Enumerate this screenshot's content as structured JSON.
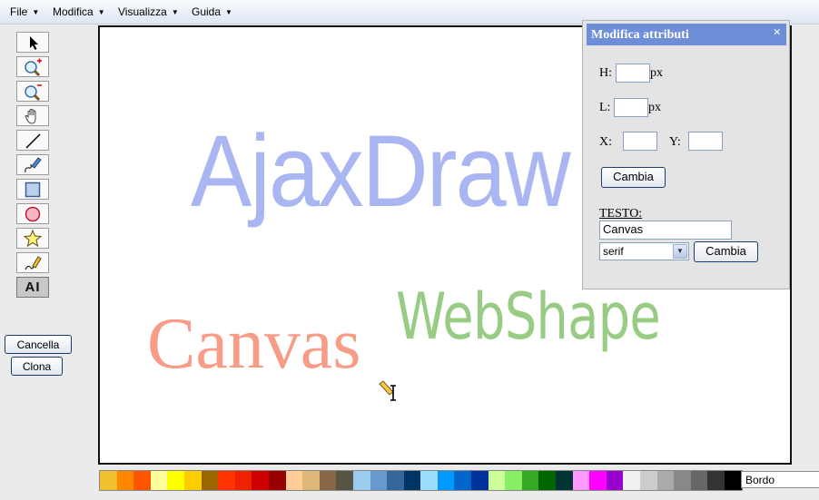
{
  "menu": [
    {
      "label": "File"
    },
    {
      "label": "Modifica"
    },
    {
      "label": "Visualizza"
    },
    {
      "label": "Guida"
    }
  ],
  "tools": [
    {
      "name": "select-arrow-icon"
    },
    {
      "name": "zoom-in-icon"
    },
    {
      "name": "zoom-out-icon"
    },
    {
      "name": "hand-pan-icon"
    },
    {
      "name": "line-icon"
    },
    {
      "name": "pen-freehand-icon"
    },
    {
      "name": "rectangle-icon"
    },
    {
      "name": "ellipse-icon"
    },
    {
      "name": "star-icon"
    },
    {
      "name": "pencil-brush-icon"
    },
    {
      "name": "text-icon",
      "label": "AI",
      "selected": true
    }
  ],
  "side_buttons": {
    "delete": "Cancella",
    "clone": "Clona"
  },
  "canvas": {
    "texts": [
      {
        "text": "AjaxDraw",
        "color": "#aab6f2"
      },
      {
        "text": "Canvas",
        "color": "#f79c86"
      },
      {
        "text": "WebShape",
        "color": "#98cc84"
      }
    ]
  },
  "palette": [
    "#f0c030",
    "#ff8800",
    "#ff5500",
    "#ffff99",
    "#ffff00",
    "#ffcc00",
    "#996600",
    "#ff3300",
    "#ee2200",
    "#cc0000",
    "#990000",
    "#ffcc99",
    "#ddb877",
    "#886644",
    "#555544",
    "#99ccee",
    "#6699cc",
    "#336699",
    "#003366",
    "#99ddff",
    "#0099ff",
    "#0066cc",
    "#003399",
    "#ccff99",
    "#88ee66",
    "#33aa22",
    "#006600",
    "#003333",
    "#ff99ff",
    "#ff00ff",
    "#9900cc",
    "#f0f0f0",
    "#cccccc",
    "#aaaaaa",
    "#888888",
    "#666666",
    "#333333",
    "#000000"
  ],
  "bordo": "Bordo",
  "panel": {
    "title": "Modifica attributi",
    "close": "×",
    "h_label": "H:",
    "l_label": "L:",
    "px": "px",
    "x_label": "X:",
    "y_label": "Y:",
    "change_label": "Cambia",
    "testo_label": "TESTO:",
    "text_value": "Canvas",
    "font_value": "serif"
  }
}
